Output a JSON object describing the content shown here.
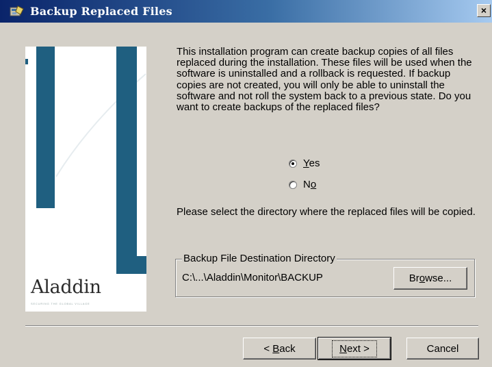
{
  "window": {
    "title": "Backup Replaced Files",
    "close_glyph": "×",
    "icon": "installer-icon"
  },
  "side_panel": {
    "logo_text": "Aladdin",
    "tagline": "SECURING THE GLOBAL VILLAGE",
    "accent_color": "#1f5f80"
  },
  "description": "This installation program can create backup copies of all files replaced during the installation. These files will be used when the software is uninstalled and a rollback is requested.  If backup copies are not created, you will only be able to uninstall the software and not roll the system back to a previous state.  Do you want to create backups of the replaced files?",
  "options": {
    "yes": {
      "label_mnemonic": "Y",
      "label_rest": "es",
      "checked": true
    },
    "no": {
      "label_prefix": "N",
      "label_mnemonic": "o",
      "checked": false
    }
  },
  "directory_prompt": "Please select the directory where the replaced  files will be copied.",
  "destination": {
    "group_label": "Backup File Destination Directory",
    "path": "C:\\...\\Aladdin\\Monitor\\BACKUP",
    "browse": {
      "pre": "Br",
      "mnemonic": "o",
      "post": "wse..."
    }
  },
  "buttons": {
    "back": {
      "pre": "< ",
      "mnemonic": "B",
      "post": "ack"
    },
    "next": {
      "mnemonic": "N",
      "post": "ext >"
    },
    "cancel": "Cancel"
  }
}
